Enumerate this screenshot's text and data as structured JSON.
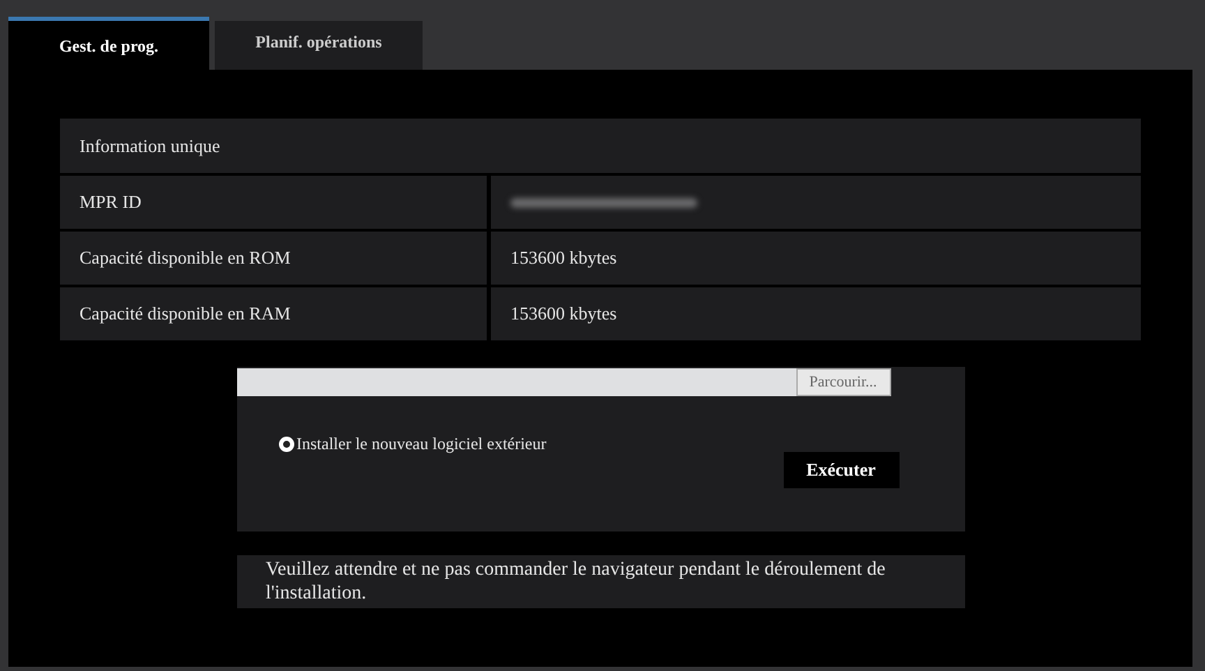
{
  "tabs": [
    {
      "label": "Gest. de prog.",
      "selected": true
    },
    {
      "label": "Planif. opérations",
      "selected": false
    }
  ],
  "info_table": {
    "title": "Information unique",
    "rows": [
      {
        "label": "MPR ID",
        "redacted": true
      },
      {
        "label": "Capacité disponible en ROM",
        "value": "153600 kbytes",
        "redacted": false
      },
      {
        "label": "Capacité disponible en RAM",
        "value": "153600 kbytes",
        "redacted": false
      }
    ]
  },
  "upload": {
    "browse_button": "Parcourir...",
    "option": {
      "label": "Installer le nouveau logiciel extérieur",
      "selected": true
    },
    "execute_button": "Exécuter"
  },
  "notice": "Veuillez attendre et ne pas commander le navigateur pendant le déroulement de l'installation."
}
